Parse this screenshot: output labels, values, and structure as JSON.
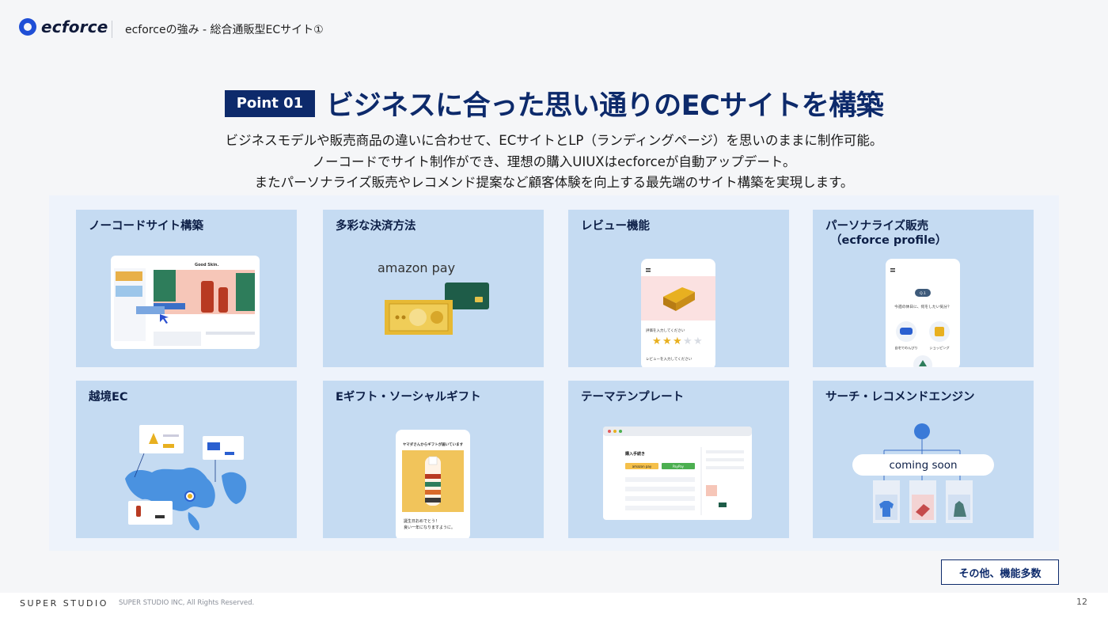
{
  "header": {
    "logo_text": "ecforce",
    "title": "ecforceの強み - 総合通販型ECサイト①"
  },
  "headline": {
    "badge": "Point 01",
    "text": "ビジネスに合った思い通りのECサイトを構築"
  },
  "lead": [
    "ビジネスモデルや販売商品の違いに合わせて、ECサイトとLP（ランディングページ）を思いのままに制作可能。",
    "ノーコードでサイト制作ができ、理想の購入UIUXはecforceが自動アップデート。",
    "またパーソナライズ販売やレコメンド提案など顧客体験を向上する最先端のサイト構築を実現します。"
  ],
  "cards": [
    {
      "title": "ノーコードサイト構築",
      "sub": "",
      "shop_label": "Good Skin."
    },
    {
      "title": "多彩な決済方法",
      "sub": "",
      "logo_label": "amazon pay"
    },
    {
      "title": "レビュー機能",
      "sub": "",
      "prompt": "評価を入力してください",
      "prompt2": "レビューを入力してください",
      "rating": 3,
      "rating_max": 5
    },
    {
      "title": "パーソナライズ販売",
      "sub": "（ecforce profile）",
      "question": "今週の休日に、何をしたい気分？",
      "q_badge": "Q.1",
      "opt1": "自宅でのんびり",
      "opt2": "ショッピング"
    },
    {
      "title": "越境EC",
      "sub": ""
    },
    {
      "title": "Eギフト・ソーシャルギフト",
      "sub": "",
      "gift_header": "ヤマダさんからギフトが届いています",
      "gift_msg1": "誕生日おめでとう！",
      "gift_msg2": "良い一年になりますように。"
    },
    {
      "title": "テーマテンプレート",
      "sub": "",
      "form_title": "購入手続き",
      "pay1": "amazon pay",
      "pay2": "PayPay"
    },
    {
      "title": "サーチ・レコメンドエンジン",
      "sub": "",
      "coming_soon": "coming soon"
    }
  ],
  "more_button": "その他、機能多数",
  "footer": {
    "brand": "SUPER STUDIO",
    "copyright": "SUPER STUDIO INC, All Rights Reserved.",
    "page": "12"
  },
  "colors": {
    "navy": "#0d2a6b",
    "card_bg": "#c5dbf2",
    "panel_bg": "#eef3fb",
    "accent_blue": "#1f4fd6"
  }
}
